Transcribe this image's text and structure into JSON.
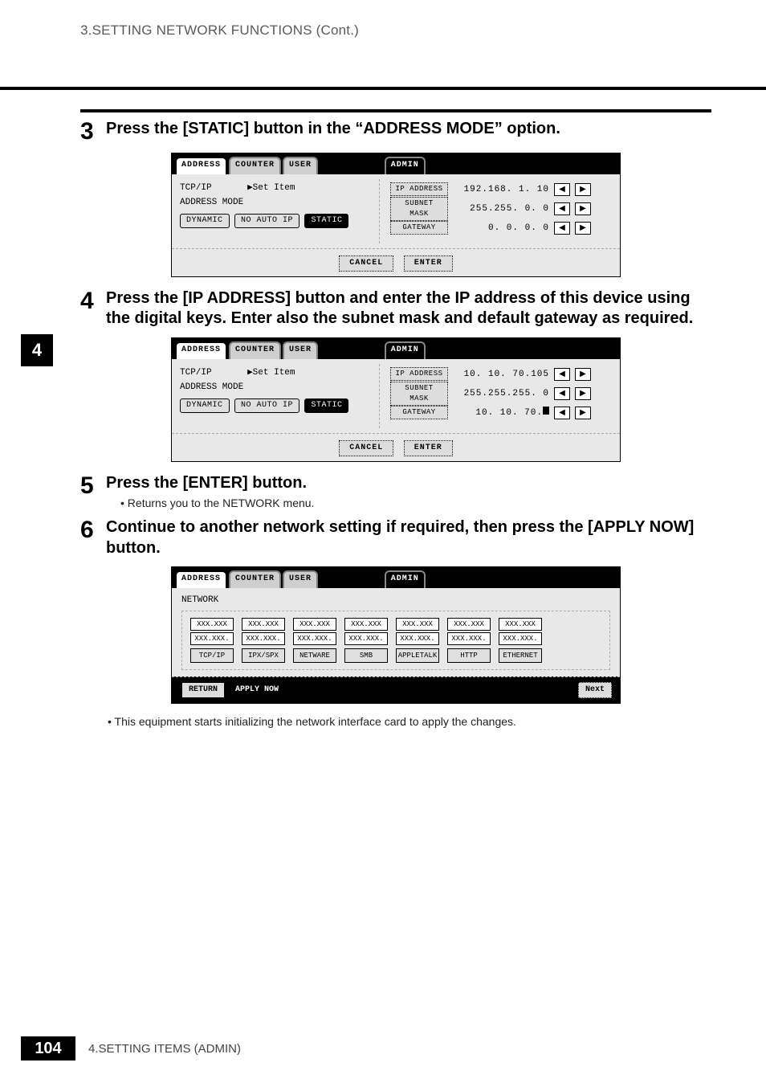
{
  "header": {
    "breadcrumb": "3.SETTING NETWORK FUNCTIONS (Cont.)"
  },
  "side_tab": "4",
  "steps": {
    "s3": {
      "num": "3",
      "title": "Press the [STATIC] button in the “ADDRESS MODE” option."
    },
    "s4": {
      "num": "4",
      "title": "Press the [IP ADDRESS] button and enter the IP address of this device using the digital keys.  Enter also the subnet mask and default gateway as required."
    },
    "s5": {
      "num": "5",
      "title": "Press the [ENTER] button.",
      "bullet": "Returns you to the NETWORK menu."
    },
    "s6": {
      "num": "6",
      "title": "Continue to another network setting if required, then press the [APPLY NOW] button.",
      "bullet": "This equipment starts initializing the network interface card to apply the changes."
    }
  },
  "lcd": {
    "tabs": {
      "address": "ADDRESS",
      "counter": "COUNTER",
      "user": "USER",
      "admin": "ADMIN"
    },
    "tcpip": "TCP/IP",
    "set_item": "▶Set Item",
    "address_mode": "ADDRESS MODE",
    "modes": {
      "dynamic": "DYNAMIC",
      "noautoip": "NO AUTO IP",
      "static": "STATIC"
    },
    "labels": {
      "ip": "IP ADDRESS",
      "subnet": "SUBNET MASK",
      "gateway": "GATEWAY"
    },
    "cancel": "CANCEL",
    "enter": "ENTER"
  },
  "panel1_values": {
    "ip": "192.168.  1. 10",
    "subnet": "255.255.  0.  0",
    "gateway": "  0.  0.  0.  0"
  },
  "panel2_values": {
    "ip": " 10. 10. 70.105",
    "subnet": "255.255.255.  0",
    "gateway_prefix": " 10. 10. 70."
  },
  "net_panel": {
    "label": "NETWORK",
    "placeholder1": "XXX.XXX",
    "placeholder2": "XXX.XXX.",
    "cards": [
      "TCP/IP",
      "IPX/SPX",
      "NETWARE",
      "SMB",
      "APPLETALK",
      "HTTP",
      "ETHERNET"
    ],
    "return": "RETURN",
    "apply": "APPLY NOW",
    "next": "Next"
  },
  "footer": {
    "page": "104",
    "text": "4.SETTING ITEMS (ADMIN)"
  }
}
